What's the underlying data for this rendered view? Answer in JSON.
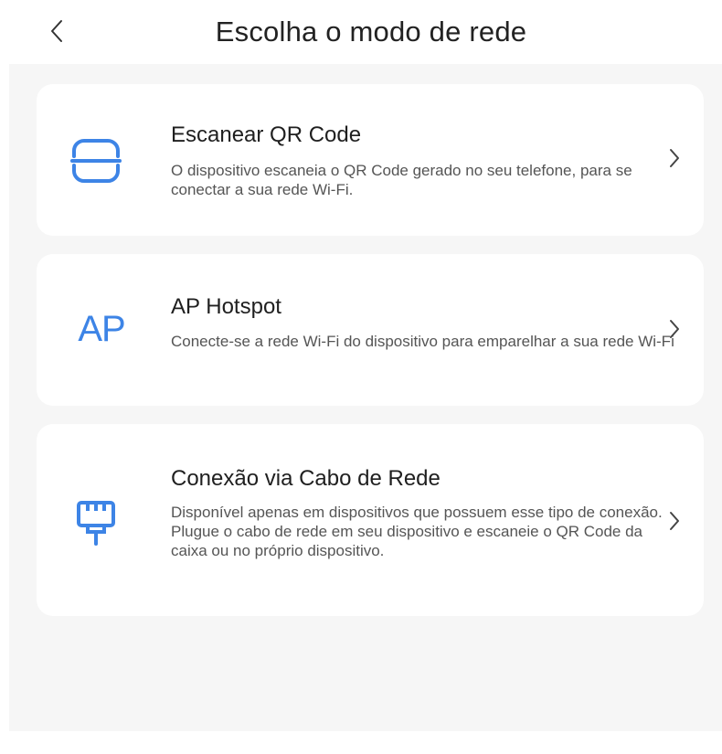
{
  "header": {
    "title": "Escolha o modo de rede",
    "back_icon": "chevron-left-icon"
  },
  "options": [
    {
      "icon": "qr-scan-icon",
      "title": "Escanear QR Code",
      "description": "O dispositivo escaneia o QR Code gerado no seu telefone, para se conectar a sua rede Wi-Fi."
    },
    {
      "icon": "ap-icon",
      "icon_text": "AP",
      "title": "AP Hotspot",
      "description": "Conecte-se a rede Wi-Fi do dispositivo para emparelhar a sua rede Wi-Fi"
    },
    {
      "icon": "ethernet-cable-icon",
      "title": "Conexão via Cabo de Rede",
      "description": "Disponível apenas em dispositivos que possuem esse tipo de conexão. Plugue o cabo de rede em seu dispositivo e escaneie o QR Code da caixa ou no próprio dispositivo."
    }
  ],
  "colors": {
    "accent": "#3d84e6",
    "background": "#f6f6f6",
    "card": "#ffffff"
  }
}
